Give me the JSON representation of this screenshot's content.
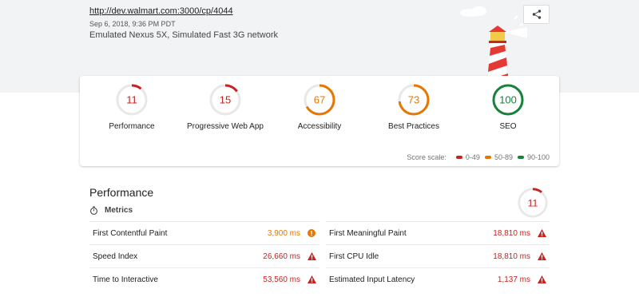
{
  "header": {
    "url": "http://dev.walmart.com:3000/cp/4044",
    "date": "Sep 6, 2018, 9:36 PM PDT",
    "environment": "Emulated Nexus 5X, Simulated Fast 3G network"
  },
  "categories": [
    {
      "label": "Performance",
      "score": "11",
      "fraction": 0.11,
      "color": "#c7221f"
    },
    {
      "label": "Progressive Web App",
      "score": "15",
      "fraction": 0.15,
      "color": "#c7221f"
    },
    {
      "label": "Accessibility",
      "score": "67",
      "fraction": 0.67,
      "color": "#e67700"
    },
    {
      "label": "Best Practices",
      "score": "73",
      "fraction": 0.73,
      "color": "#e67700"
    },
    {
      "label": "SEO",
      "score": "100",
      "fraction": 1.0,
      "color": "#178239"
    }
  ],
  "scale": {
    "label": "Score scale:",
    "ranges": [
      {
        "label": "0-49",
        "color": "#c7221f"
      },
      {
        "label": "50-89",
        "color": "#e67700"
      },
      {
        "label": "90-100",
        "color": "#178239"
      }
    ]
  },
  "performance": {
    "title": "Performance",
    "score": "11",
    "fraction": 0.11,
    "metrics_label": "Metrics",
    "metrics": [
      {
        "name": "First Contentful Paint",
        "value": "3,900 ms",
        "status": "average"
      },
      {
        "name": "First Meaningful Paint",
        "value": "18,810 ms",
        "status": "fail"
      },
      {
        "name": "Speed Index",
        "value": "26,660 ms",
        "status": "fail"
      },
      {
        "name": "First CPU Idle",
        "value": "18,810 ms",
        "status": "fail"
      },
      {
        "name": "Time to Interactive",
        "value": "53,560 ms",
        "status": "fail"
      },
      {
        "name": "Estimated Input Latency",
        "value": "1,137 ms",
        "status": "fail"
      }
    ]
  },
  "icons": {
    "share": "share-icon",
    "stopwatch": "stopwatch-icon",
    "warning": "warning-triangle-icon",
    "info": "info-circle-icon"
  }
}
